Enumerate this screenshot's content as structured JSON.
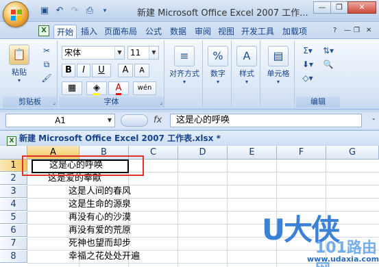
{
  "window": {
    "title": "新建 Microsoft Office Excel 2007 工作...",
    "office_icon": "office-logo-icon"
  },
  "qat": [
    "save-icon",
    "undo-icon",
    "redo-icon",
    "print-preview-icon",
    "customize-icon"
  ],
  "tabs": [
    "开始",
    "插入",
    "页面布局",
    "公式",
    "数据",
    "审阅",
    "视图",
    "开发工具",
    "加载项"
  ],
  "ribbon": {
    "clipboard": {
      "label": "剪贴板",
      "paste": "粘贴"
    },
    "font": {
      "label": "字体",
      "name": "宋体",
      "size": "11",
      "bold": "B",
      "italic": "I",
      "underline": "U",
      "grow": "A",
      "shrink": "A",
      "fontcolor": "A",
      "phonetic": "wén"
    },
    "align": {
      "label": "对齐方式"
    },
    "number": {
      "label": "数字",
      "symbol": "%"
    },
    "styles": {
      "label": "样式"
    },
    "cells": {
      "label": "单元格"
    },
    "editing": {
      "label": "编辑",
      "sigma": "Σ"
    }
  },
  "formula_bar": {
    "name_box": "A1",
    "fx": "fx",
    "content": "这是心的呼唤"
  },
  "workbook": {
    "title": "新建 Microsoft Office Excel 2007 工作表.xlsx *"
  },
  "grid": {
    "columns": [
      "A",
      "B",
      "C",
      "D",
      "E",
      "F",
      "G"
    ],
    "rows": [
      "1",
      "2",
      "3",
      "4",
      "5",
      "6",
      "7",
      "8"
    ],
    "cells": [
      "这是心的呼唤",
      "这是爱的奉献",
      "这是人间的春风",
      "这是生命的源泉",
      "再没有心的沙漠",
      "再没有爱的荒原",
      "死神也望而却步",
      "幸福之花处处开遍"
    ]
  },
  "watermark": {
    "big": "U大侠",
    "site": "101路由网",
    "url": "www.udaxia.com"
  }
}
